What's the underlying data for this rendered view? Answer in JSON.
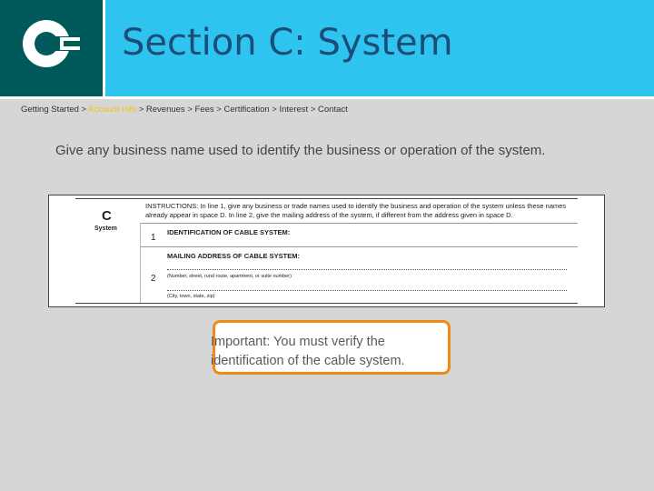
{
  "header": {
    "title": "Section C: System",
    "logo_letter": "C",
    "colors": {
      "banner": "#2fc4ef",
      "logo_bg": "#00595a",
      "title": "#1a4e79"
    }
  },
  "breadcrumb": {
    "items": [
      {
        "label": "Getting Started",
        "current": false
      },
      {
        "label": "Account Info",
        "current": true
      },
      {
        "label": "Revenues",
        "current": false
      },
      {
        "label": "Fees",
        "current": false
      },
      {
        "label": "Certification",
        "current": false
      },
      {
        "label": "Interest",
        "current": false
      },
      {
        "label": "Contact",
        "current": false
      }
    ],
    "separator": ">"
  },
  "description": "Give any business name used to identify the business or operation of the system.",
  "form": {
    "section_letter": "C",
    "section_label": "System",
    "instructions": "INSTRUCTIONS: In line 1, give any business or trade names used to identify the business and operation of the system unless these names already appear in space D. In line 2, give the mailing address of the system, if different from the address given in space D.",
    "line1_number": "1",
    "line1_label": "IDENTIFICATION OF CABLE SYSTEM:",
    "mailing_label": "MAILING ADDRESS OF CABLE SYSTEM:",
    "line2_number": "2",
    "street_hint": "(Number, street, rural route, apartment, or suite number)",
    "city_hint": "(City, town, state, zip)"
  },
  "callout": {
    "text": "Important: You must verify the identification of the cable system.",
    "border_color": "#ef8a1a"
  }
}
